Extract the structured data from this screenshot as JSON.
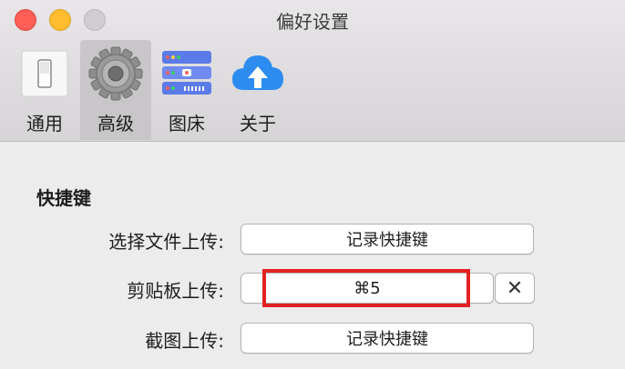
{
  "window": {
    "title": "偏好设置"
  },
  "toolbar": {
    "tabs": [
      {
        "label": "通用",
        "icon": "switch-icon"
      },
      {
        "label": "高级",
        "icon": "gear-icon"
      },
      {
        "label": "图床",
        "icon": "server-icon"
      },
      {
        "label": "关于",
        "icon": "cloud-upload-icon"
      }
    ],
    "selected": "高级"
  },
  "shortcuts": {
    "section_title": "快捷键",
    "rows": [
      {
        "label": "选择文件上传:",
        "value": "记录快捷键"
      },
      {
        "label": "剪贴板上传:",
        "value": "⌘5",
        "clear": "✕"
      },
      {
        "label": "截图上传:",
        "value": "记录快捷键"
      }
    ]
  },
  "colors": {
    "highlight": "#e32121",
    "close": "#fe5f57",
    "minimize": "#febc2e",
    "cloud": "#2d8cf0"
  }
}
